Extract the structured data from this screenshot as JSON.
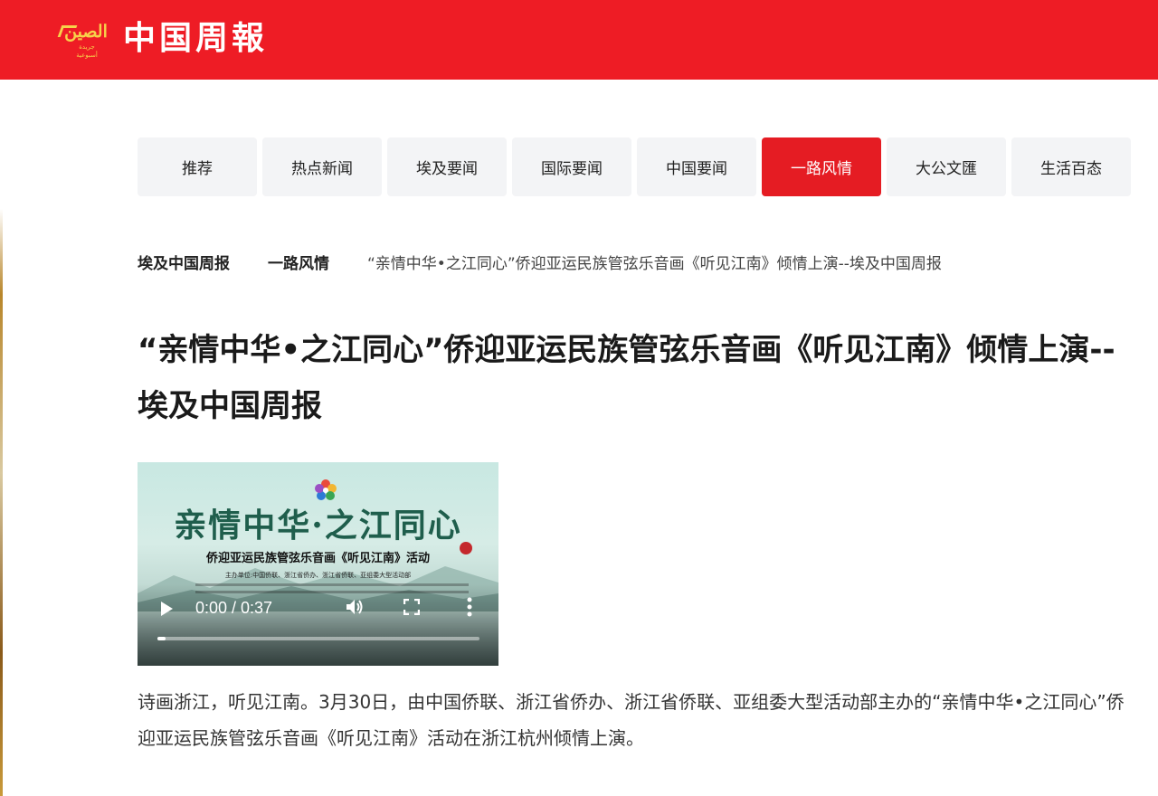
{
  "header": {
    "logo_arabic": "الصين",
    "logo_arabic_sub": "جريدة أسبوعية",
    "logo_text": "中国周報",
    "accent_color": "#ee1c25"
  },
  "nav": {
    "tabs": [
      {
        "label": "推荐",
        "active": false
      },
      {
        "label": "热点新闻",
        "active": false
      },
      {
        "label": "埃及要闻",
        "active": false
      },
      {
        "label": "国际要闻",
        "active": false
      },
      {
        "label": "中国要闻",
        "active": false
      },
      {
        "label": "一路风情",
        "active": true
      },
      {
        "label": "大公文匯",
        "active": false
      },
      {
        "label": "生活百态",
        "active": false
      }
    ]
  },
  "breadcrumb": {
    "site": "埃及中国周报",
    "section": "一路风情",
    "current": "“亲情中华•之江同心”侨迎亚运民族管弦乐音画《听见江南》倾情上演--埃及中国周报"
  },
  "article": {
    "title": "“亲情中华•之江同心”侨迎亚运民族管弦乐音画《听见江南》倾情上演--埃及中国周报",
    "video": {
      "poster_title": "亲情中华·之江同心",
      "poster_subtitle": "侨迎亚运民族管弦乐音画《听见江南》活动",
      "poster_organizers": "主办单位:中国侨联、浙江省侨办、浙江省侨联、亚组委大型活动部",
      "time_display": "0:00 / 0:37",
      "progress": 0.0
    },
    "paragraph": "诗画浙江，听见江南。3月30日，由中国侨联、浙江省侨办、浙江省侨联、亚组委大型活动部主办的“亲情中华•之江同心”侨迎亚运民族管弦乐音画《听见江南》活动在浙江杭州倾情上演。"
  }
}
